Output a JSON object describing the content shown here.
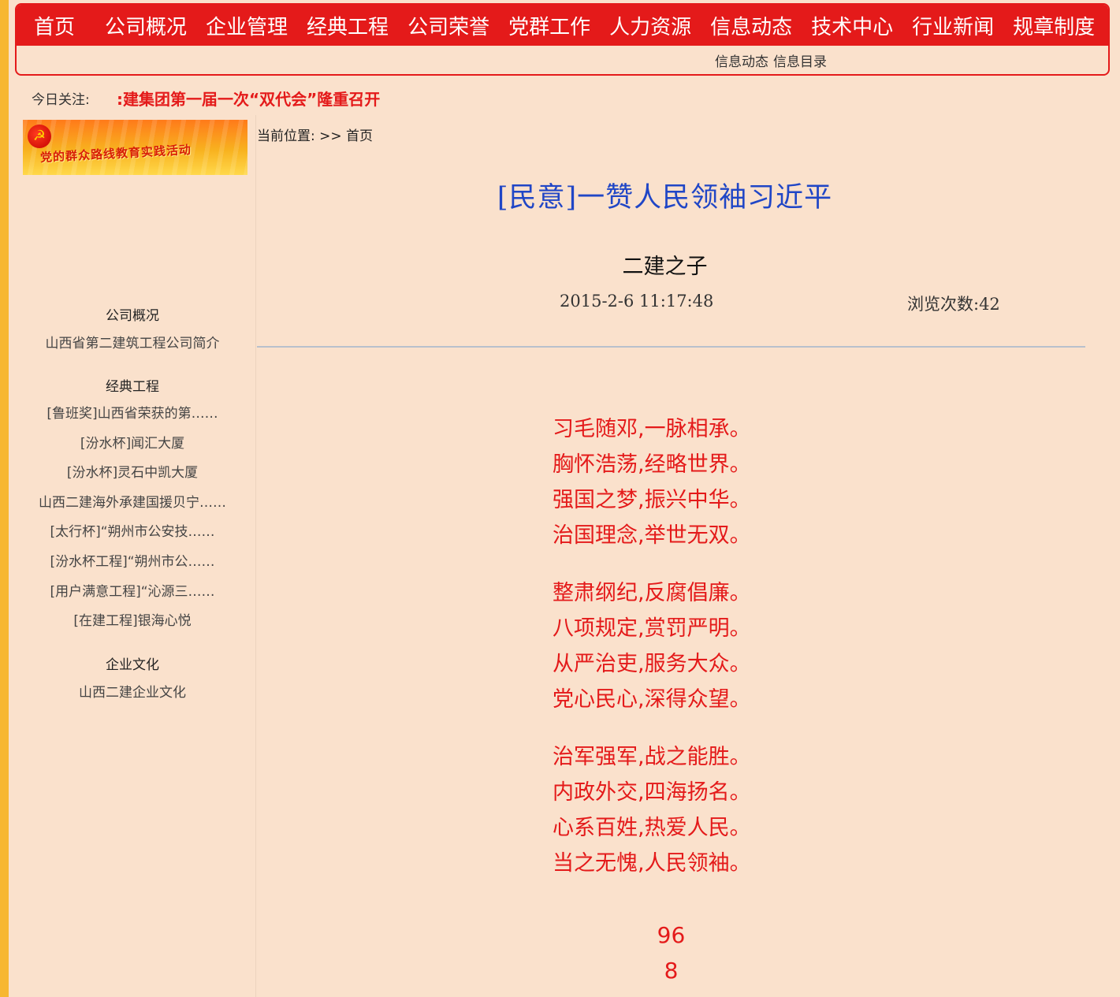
{
  "nav": {
    "items": [
      "首页",
      "公司概况",
      "企业管理",
      "经典工程",
      "公司荣誉",
      "党群工作",
      "人力资源",
      "信息动态",
      "技术中心",
      "行业新闻",
      "规章制度"
    ],
    "sub": [
      "信息动态",
      "信息目录"
    ]
  },
  "today": {
    "label": "今日关注:",
    "headline": ":建集团第一届一次“双代会”隆重召开"
  },
  "sidebar": {
    "banner_text": "党的群众路线教育实践活动",
    "sections": [
      {
        "title": "公司概况",
        "links": [
          "山西省第二建筑工程公司简介"
        ]
      },
      {
        "title": "经典工程",
        "links": [
          "[鲁班奖]山西省荣获的第……",
          "[汾水杯]闻汇大厦",
          "[汾水杯]灵石中凯大厦",
          "山西二建海外承建国援贝宁……",
          "[太行杯]“朔州市公安技……",
          "[汾水杯工程]“朔州市公……",
          "[用户满意工程]“沁源三……",
          "[在建工程]银海心悦"
        ]
      },
      {
        "title": "企业文化",
        "links": [
          "山西二建企业文化"
        ]
      }
    ]
  },
  "breadcrumb": {
    "label": "当前位置:",
    "sep": ">>",
    "home": "首页"
  },
  "article": {
    "title": "[民意]一赞人民领袖习近平",
    "author": "二建之子",
    "date": "2015-2-6  11:17:48",
    "views": "浏览次数:42",
    "stanzas": [
      [
        "习毛随邓,一脉相承。",
        "胸怀浩荡,经略世界。",
        "强国之梦,振兴中华。",
        "治国理念,举世无双。"
      ],
      [
        "整肃纲纪,反腐倡廉。",
        "八项规定,赏罚严明。",
        "从严治吏,服务大众。",
        "党心民心,深得众望。"
      ],
      [
        "治军强军,战之能胜。",
        "内政外交,四海扬名。",
        "心系百姓,热爱人民。",
        "当之无愧,人民领袖。"
      ]
    ],
    "footer_numbers": [
      "96",
      "8"
    ]
  },
  "colors": {
    "nav_red": "#e41a1a",
    "title_blue": "#2046c6",
    "page_bg": "#fae1cc",
    "outer_bg": "#f7b731"
  }
}
